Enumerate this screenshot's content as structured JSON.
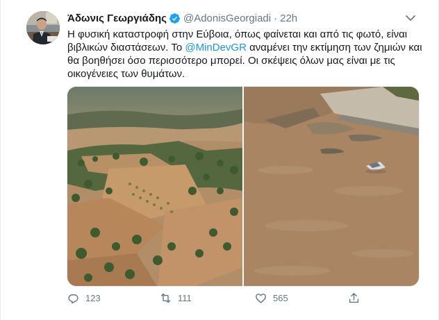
{
  "tweet": {
    "author": {
      "display_name": "Άδωνις Γεωργιάδης",
      "handle": "@AdonisGeorgiadi",
      "verified": true
    },
    "separator": "·",
    "time": "22h",
    "text": {
      "part1": "Η φυσική καταστροφή στην Εύβοια, όπως φαίνεται και από τις φωτό, είναι βιβλικών διαστάσεων. Το ",
      "mention": "@MinDevGR",
      "part2": " αναμένει την εκτίμηση των ζημιών και θα βοηθήσει όσο περισσότερο μπορεί. Οι σκέψεις όλων μας είναι με τις οικογένειες των θυμάτων."
    },
    "media": {
      "count": 2,
      "photos": [
        "flooded-fields-aerial-photo",
        "flooded-road-with-car-photo"
      ]
    },
    "actions": {
      "reply_count": "123",
      "retweet_count": "111",
      "like_count": "565"
    },
    "colors": {
      "link": "#1b95e0",
      "secondary_text": "#657786",
      "verified_badge": "#1da1f2",
      "flood_water": "#a98563"
    }
  }
}
